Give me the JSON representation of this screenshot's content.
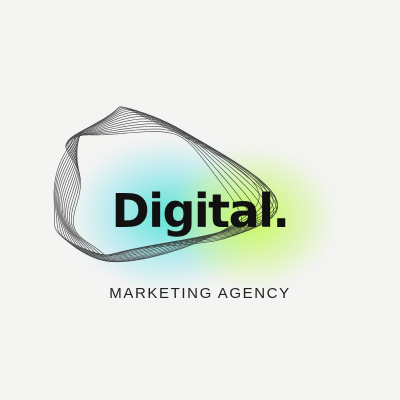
{
  "logo": {
    "wordmark": "Digital.",
    "tagline": "MARKETING AGENCY"
  },
  "colors": {
    "background": "#f4f4f3",
    "text": "#111111",
    "accent_cyan": "#40e0d0",
    "accent_lime": "#bef a3c"
  },
  "icons": {
    "mark": "wave-lines-icon"
  }
}
